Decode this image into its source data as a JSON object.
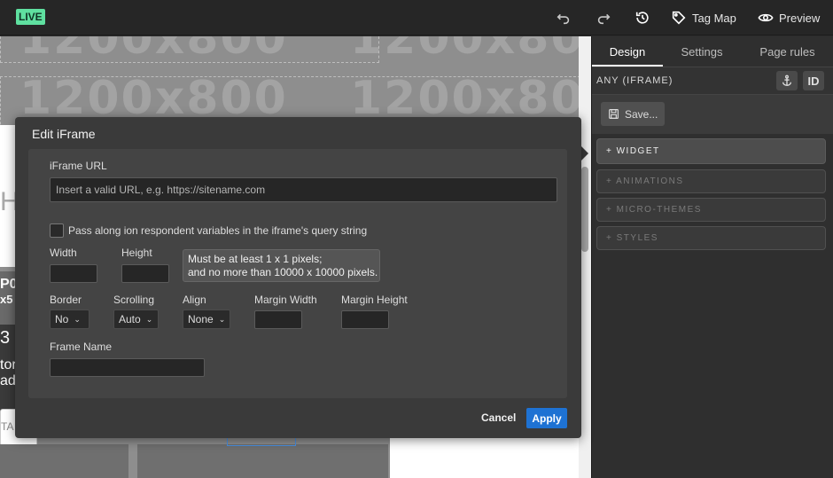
{
  "topbar": {
    "live_badge": "LIVE",
    "undo_icon": "undo-icon",
    "redo_icon": "redo-icon",
    "history_icon": "history-icon",
    "tag_map_label": "Tag Map",
    "preview_label": "Preview"
  },
  "canvas": {
    "placeholder_text": "1200x800",
    "placeholder_text_partial": "1200x80",
    "left_fragments": [
      "H",
      "P0",
      "x5",
      "3",
      "tor",
      "ad",
      "TA"
    ]
  },
  "panel": {
    "tabs": [
      {
        "label": "Design",
        "active": true
      },
      {
        "label": "Settings",
        "active": false
      },
      {
        "label": "Page rules",
        "active": false
      }
    ],
    "selection_label": "ANY (IFRAME)",
    "id_button": "ID",
    "save_label": "Save...",
    "accordions": [
      {
        "label": "+ WIDGET",
        "active": true
      },
      {
        "label": "+ ANIMATIONS",
        "active": false
      },
      {
        "label": "+ MICRO-THEMES",
        "active": false
      },
      {
        "label": "+ STYLES",
        "active": false
      }
    ]
  },
  "modal": {
    "title": "Edit iFrame",
    "url_label": "iFrame URL",
    "url_placeholder": "Insert a valid URL, e.g. https://sitename.com",
    "pass_vars_label": "Pass along ion respondent variables in the iframe's query string",
    "width_label": "Width",
    "height_label": "Height",
    "hint_line1": "Must be at least 1 x 1 pixels;",
    "hint_line2": "and no more than 10000 x 10000 pixels.",
    "border_label": "Border",
    "border_value": "No",
    "scrolling_label": "Scrolling",
    "scrolling_value": "Auto",
    "align_label": "Align",
    "align_value": "None",
    "margin_width_label": "Margin Width",
    "margin_height_label": "Margin Height",
    "frame_name_label": "Frame Name",
    "cancel_label": "Cancel",
    "apply_label": "Apply"
  }
}
